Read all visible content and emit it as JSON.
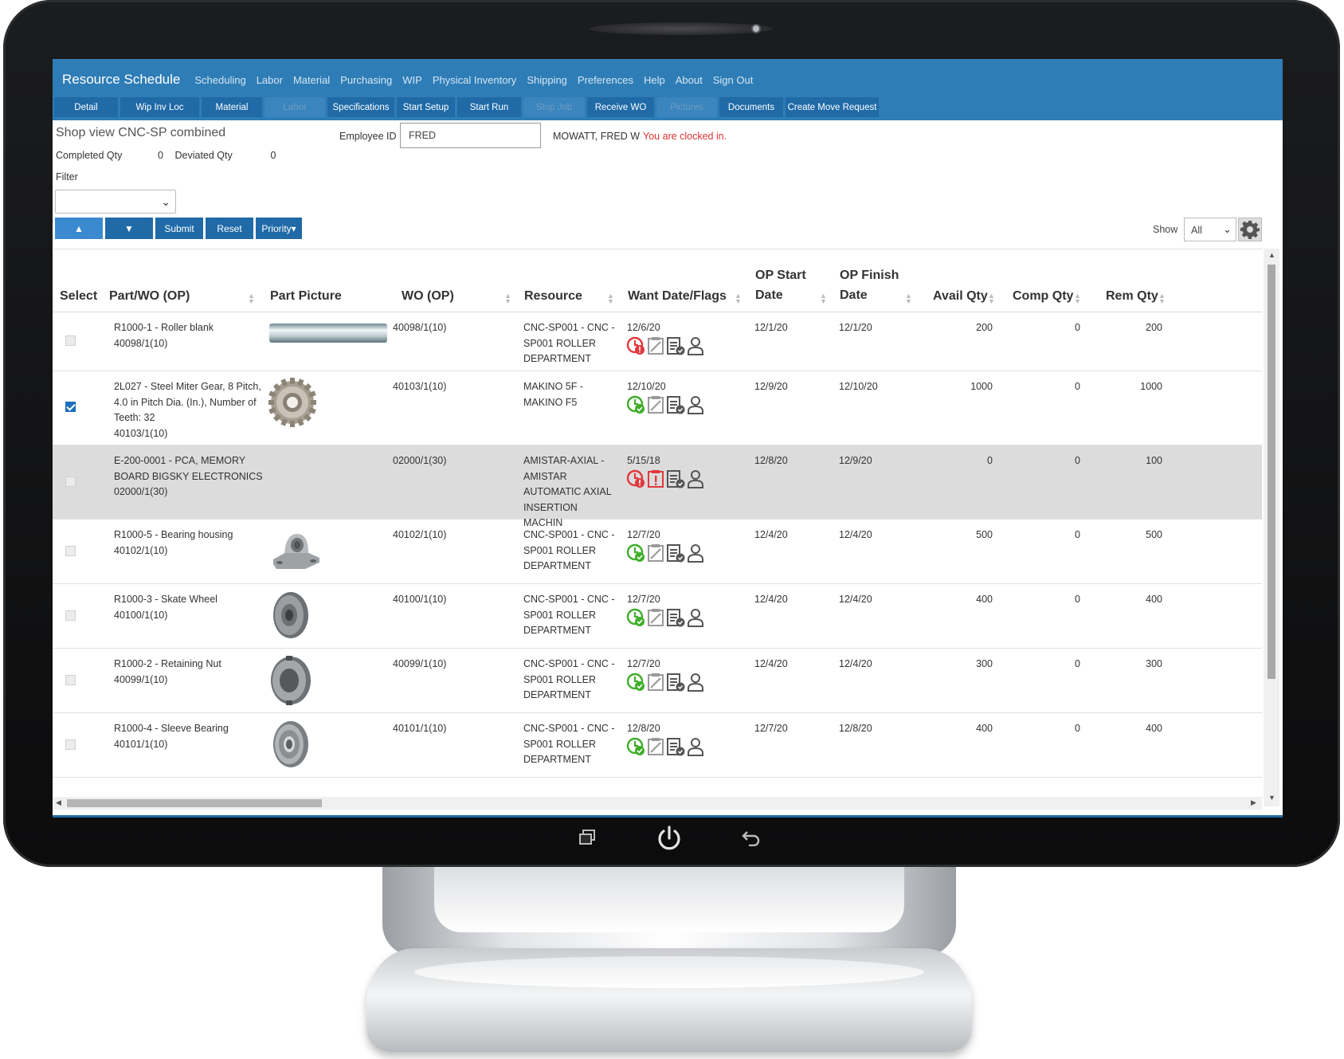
{
  "nav": {
    "app_title": "Resource Schedule",
    "links": [
      "Scheduling",
      "Labor",
      "Material",
      "Purchasing",
      "WIP",
      "Physical Inventory",
      "Shipping",
      "Preferences",
      "Help",
      "About",
      "Sign Out"
    ]
  },
  "toolbar": {
    "buttons": [
      {
        "label": "Detail",
        "enabled": true
      },
      {
        "label": "Wip Inv Loc",
        "enabled": true
      },
      {
        "label": "Material",
        "enabled": true
      },
      {
        "label": "Labor",
        "enabled": false
      },
      {
        "label": "Specifications",
        "enabled": true
      },
      {
        "label": "Start Setup",
        "enabled": true
      },
      {
        "label": "Start Run",
        "enabled": true
      },
      {
        "label": "Stop Job",
        "enabled": false
      },
      {
        "label": "Receive WO",
        "enabled": true
      },
      {
        "label": "Pictures",
        "enabled": false
      },
      {
        "label": "Documents",
        "enabled": true
      },
      {
        "label": "Create Move Request",
        "enabled": true
      }
    ]
  },
  "header": {
    "shop_view": "Shop view CNC-SP combined",
    "completed_label": "Completed Qty",
    "completed_value": "0",
    "deviated_label": "Deviated Qty",
    "deviated_value": "0",
    "filter_label": "Filter",
    "filter_value": "",
    "employee_label": "Employee ID",
    "employee_value": "FRED",
    "employee_name": "MOWATT, FRED W",
    "clock_status": "You are clocked in."
  },
  "actions": {
    "up": "▲",
    "down": "▼",
    "submit": "Submit",
    "reset": "Reset",
    "priority": "Priority▾",
    "show_label": "Show",
    "show_value": "All"
  },
  "table": {
    "headers": {
      "select": "Select",
      "part": "Part/WO (OP)",
      "picture": "Part Picture",
      "wo": "WO (OP)",
      "resource": "Resource",
      "want": "Want Date/Flags",
      "op_start_1": "OP Start",
      "op_start_2": "Date",
      "op_finish_1": "OP Finish",
      "op_finish_2": "Date",
      "avail": "Avail Qty",
      "comp": "Comp Qty",
      "rem": "Rem Qty"
    },
    "rows": [
      {
        "checked": false,
        "part": [
          "R1000-1 - Roller blank",
          "40098/1(10)"
        ],
        "picture": "roller-blank",
        "wo": "40098/1(10)",
        "resource": [
          "CNC-SP001 - CNC -",
          "SP001 ROLLER",
          "DEPARTMENT"
        ],
        "want": "12/6/20",
        "clock": "late",
        "note": "normal",
        "op_start": "12/1/20",
        "op_finish": "12/1/20",
        "avail": "200",
        "comp": "0",
        "rem": "200"
      },
      {
        "checked": true,
        "part": [
          "2L027 - Steel Miter Gear, 8 Pitch,",
          "4.0 in Pitch Dia. (In.), Number of",
          "Teeth: 32",
          "40103/1(10)"
        ],
        "picture": "miter-gear",
        "wo": "40103/1(10)",
        "resource": [
          "MAKINO 5F -",
          "MAKINO F5"
        ],
        "want": "12/10/20",
        "clock": "ok",
        "note": "normal",
        "op_start": "12/9/20",
        "op_finish": "12/10/20",
        "avail": "1000",
        "comp": "0",
        "rem": "1000"
      },
      {
        "checked": false,
        "part": [
          "E-200-0001 - PCA, MEMORY",
          "BOARD BIGSKY ELECTRONICS",
          "02000/1(30)"
        ],
        "picture": "",
        "wo": "02000/1(30)",
        "resource": [
          "AMISTAR-AXIAL -",
          "AMISTAR",
          "AUTOMATIC AXIAL",
          "INSERTION MACHIN"
        ],
        "want": "5/15/18",
        "clock": "late",
        "note": "alert",
        "op_start": "12/8/20",
        "op_finish": "12/9/20",
        "avail": "0",
        "comp": "0",
        "rem": "100"
      },
      {
        "checked": false,
        "part": [
          "R1000-5 - Bearing housing",
          "40102/1(10)"
        ],
        "picture": "bearing-housing",
        "wo": "40102/1(10)",
        "resource": [
          "CNC-SP001 - CNC -",
          "SP001 ROLLER",
          "DEPARTMENT"
        ],
        "want": "12/7/20",
        "clock": "ok",
        "note": "normal",
        "op_start": "12/4/20",
        "op_finish": "12/4/20",
        "avail": "500",
        "comp": "0",
        "rem": "500"
      },
      {
        "checked": false,
        "part": [
          "R1000-3 - Skate Wheel",
          "40100/1(10)"
        ],
        "picture": "skate-wheel",
        "wo": "40100/1(10)",
        "resource": [
          "CNC-SP001 - CNC -",
          "SP001 ROLLER",
          "DEPARTMENT"
        ],
        "want": "12/7/20",
        "clock": "ok",
        "note": "normal",
        "op_start": "12/4/20",
        "op_finish": "12/4/20",
        "avail": "400",
        "comp": "0",
        "rem": "400"
      },
      {
        "checked": false,
        "part": [
          "R1000-2 - Retaining Nut",
          "40099/1(10)"
        ],
        "picture": "retaining-nut",
        "wo": "40099/1(10)",
        "resource": [
          "CNC-SP001 - CNC -",
          "SP001 ROLLER",
          "DEPARTMENT"
        ],
        "want": "12/7/20",
        "clock": "ok",
        "note": "normal",
        "op_start": "12/4/20",
        "op_finish": "12/4/20",
        "avail": "300",
        "comp": "0",
        "rem": "300"
      },
      {
        "checked": false,
        "part": [
          "R1000-4 - Sleeve Bearing",
          "40101/1(10)"
        ],
        "picture": "sleeve-bearing",
        "wo": "40101/1(10)",
        "resource": [
          "CNC-SP001 - CNC -",
          "SP001 ROLLER",
          "DEPARTMENT"
        ],
        "want": "12/8/20",
        "clock": "ok",
        "note": "normal",
        "op_start": "12/7/20",
        "op_finish": "12/8/20",
        "avail": "400",
        "comp": "0",
        "rem": "400"
      }
    ]
  },
  "colors": {
    "nav_bar": "#2e7db6",
    "button": "#1f6aa7",
    "ok_green": "#3fae2a",
    "late_red": "#e0393e",
    "clock_status": "#dd3333",
    "highlight_row": "#dcdcdc"
  },
  "icons": {
    "clock_flag": "clock-icon",
    "note_flag": "notepad-icon",
    "doc_flag": "document-check-icon",
    "person_flag": "person-icon",
    "gear": "gear-icon"
  }
}
